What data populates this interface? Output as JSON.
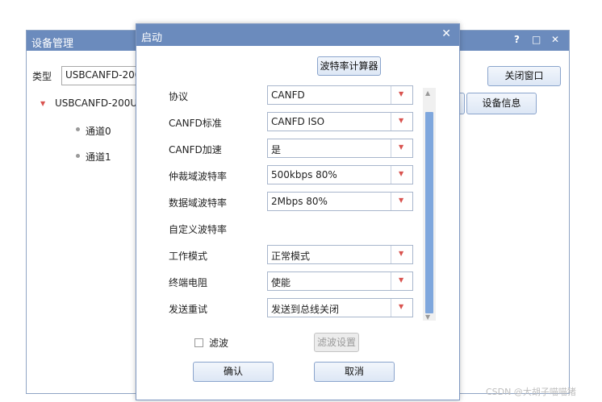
{
  "background_window": {
    "title": "设备管理",
    "controls": [
      "?",
      "□",
      "✕"
    ],
    "type_label": "类型",
    "type_value": "USBCANFD-200",
    "tree": {
      "root": "USBCANFD-200U",
      "children": [
        "通道0",
        "通道1"
      ]
    },
    "close_window_label": "关闭窗口",
    "device_info_label": "设备信息"
  },
  "dialog": {
    "title": "启动",
    "close": "✕",
    "baud_calc_label": "波特率计算器",
    "fields": [
      {
        "label": "协议",
        "value": "CANFD"
      },
      {
        "label": "CANFD标准",
        "value": "CANFD ISO"
      },
      {
        "label": "CANFD加速",
        "value": "是"
      },
      {
        "label": "仲裁域波特率",
        "value": "500kbps 80%"
      },
      {
        "label": "数据域波特率",
        "value": "2Mbps 80%"
      },
      {
        "label": "自定义波特率",
        "value": ""
      },
      {
        "label": "工作模式",
        "value": "正常模式"
      },
      {
        "label": "终端电阻",
        "value": "使能"
      },
      {
        "label": "发送重试",
        "value": "发送到总线关闭"
      }
    ],
    "filter_label": "滤波",
    "filter_settings_label": "滤波设置",
    "ok_label": "确认",
    "cancel_label": "取消"
  },
  "watermark": "CSDN @大胡子喵喵猪",
  "icons": {
    "dropdown": "dropdown-arrow-icon",
    "tree_expand": "tree-expand-icon",
    "scroll_up": "scroll-up-icon",
    "scroll_down": "scroll-down-icon"
  },
  "colors": {
    "titlebar": "#6b8bbd",
    "accent_arrow": "#d9534f",
    "scroll_thumb": "#7fa7dd"
  }
}
